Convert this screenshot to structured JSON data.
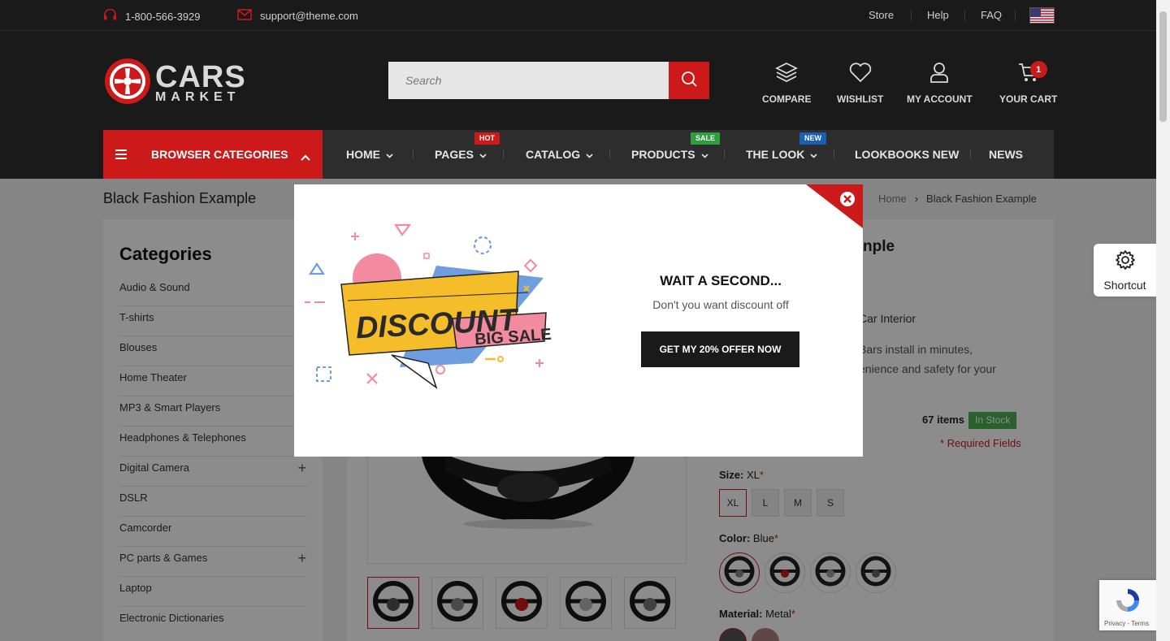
{
  "topbar": {
    "phone": "1-800-566-3929",
    "email": "support@theme.com",
    "links": [
      "Store",
      "Help",
      "FAQ"
    ]
  },
  "header": {
    "logo_line1": "CARS",
    "logo_line2": "MARKET",
    "search_placeholder": "Search",
    "icons": {
      "compare": "COMPARE",
      "wishlist": "WISHLIST",
      "account": "MY ACCOUNT",
      "cart": "YOUR CART",
      "cart_count": "1"
    }
  },
  "nav": {
    "categories_label": "BROWSER CATEGORIES",
    "items": [
      {
        "label": "HOME",
        "has_dropdown": true
      },
      {
        "label": "PAGES",
        "has_dropdown": true,
        "badge": "HOT",
        "badge_color": "#cc1a1a"
      },
      {
        "label": "CATALOG",
        "has_dropdown": true
      },
      {
        "label": "PRODUCTS",
        "has_dropdown": true,
        "badge": "SALE",
        "badge_color": "#2e9e3e"
      },
      {
        "label": "THE LOOK",
        "has_dropdown": true,
        "badge": "NEW",
        "badge_color": "#1a5fb4"
      },
      {
        "label": "LOOKBOOKS NEW",
        "has_dropdown": false
      },
      {
        "label": "NEWS",
        "has_dropdown": false
      }
    ]
  },
  "page": {
    "title": "Black Fashion Example",
    "breadcrumb": {
      "home": "Home",
      "separator": "›",
      "current": "Black Fashion Example"
    }
  },
  "sidebar": {
    "title": "Categories",
    "items": [
      {
        "label": "Audio & Sound",
        "expandable": false
      },
      {
        "label": "T-shirts",
        "expandable": false
      },
      {
        "label": "Blouses",
        "expandable": false
      },
      {
        "label": "Home Theater",
        "expandable": false
      },
      {
        "label": "MP3 & Smart Players",
        "expandable": false
      },
      {
        "label": "Headphones & Telephones",
        "expandable": false
      },
      {
        "label": "Digital Camera",
        "expandable": true
      },
      {
        "label": "DSLR",
        "expandable": false
      },
      {
        "label": "Camcorder",
        "expandable": false
      },
      {
        "label": "PC parts & Games",
        "expandable": true
      },
      {
        "label": "Laptop",
        "expandable": false
      },
      {
        "label": "Electronic Dictionaries",
        "expandable": false
      }
    ],
    "plus_symbol": "+"
  },
  "product": {
    "name_partial": "nple",
    "category_partial": "Car Interior",
    "desc_line1": "Bars install in minutes,",
    "desc_line2": "enience and safety for your",
    "stock_count": "67 items",
    "stock_status": "In Stock",
    "required_note": "* Required Fields",
    "size": {
      "label": "Size:",
      "value": "XL",
      "options": [
        "XL",
        "L",
        "M",
        "S"
      ],
      "selected": "XL"
    },
    "color": {
      "label": "Color:",
      "value": "Blue",
      "swatch_accents": [
        "#888888",
        "#cc1a1a",
        "#9a9a9a",
        "#666666"
      ],
      "selected_index": 0
    },
    "material": {
      "label": "Material:",
      "value": "Metal"
    },
    "required_mark": "*",
    "thumbnail_accents": [
      "#555555",
      "#888888",
      "#cc1a1a",
      "#b5b5b5",
      "#777777"
    ],
    "selected_thumbnail": 0
  },
  "popup": {
    "title": "WAIT A SECOND...",
    "subtitle": "Don't you want discount off",
    "button": "GET MY 20% OFFER NOW",
    "art_text_main": "DISCOUNT",
    "art_text_sub": "BIG SALE"
  },
  "shortcut": {
    "label": "Shortcut"
  },
  "recaptcha": {
    "terms": "Privacy - Terms"
  },
  "colors": {
    "accent": "#cc1a1a",
    "dark": "#1a1a1a",
    "stock_green": "#4caf50"
  }
}
